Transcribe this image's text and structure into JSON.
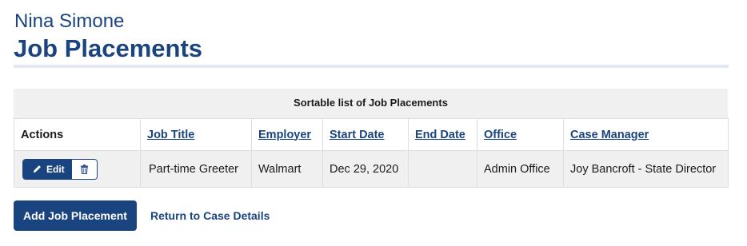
{
  "header": {
    "client_name": "Nina Simone",
    "page_title": "Job Placements"
  },
  "table": {
    "caption": "Sortable list of Job Placements",
    "columns": {
      "actions": "Actions",
      "job_title": "Job Title",
      "employer": "Employer",
      "start_date": "Start Date",
      "end_date": "End Date",
      "office": "Office",
      "case_manager": "Case Manager"
    },
    "rows": [
      {
        "edit_label": "Edit",
        "edit_icon": "pencil-icon",
        "delete_icon": "trash-icon",
        "job_title": "Part-time Greeter",
        "employer": "Walmart",
        "start_date": "Dec 29, 2020",
        "end_date": "",
        "office": "Admin Office",
        "case_manager": "Joy Bancroft - State Director"
      }
    ]
  },
  "actions": {
    "add_label": "Add Job Placement",
    "return_label": "Return to Case Details"
  },
  "colors": {
    "primary": "#1a4480",
    "rule": "#e1e9f5",
    "row_background": "#f0f0f0"
  }
}
